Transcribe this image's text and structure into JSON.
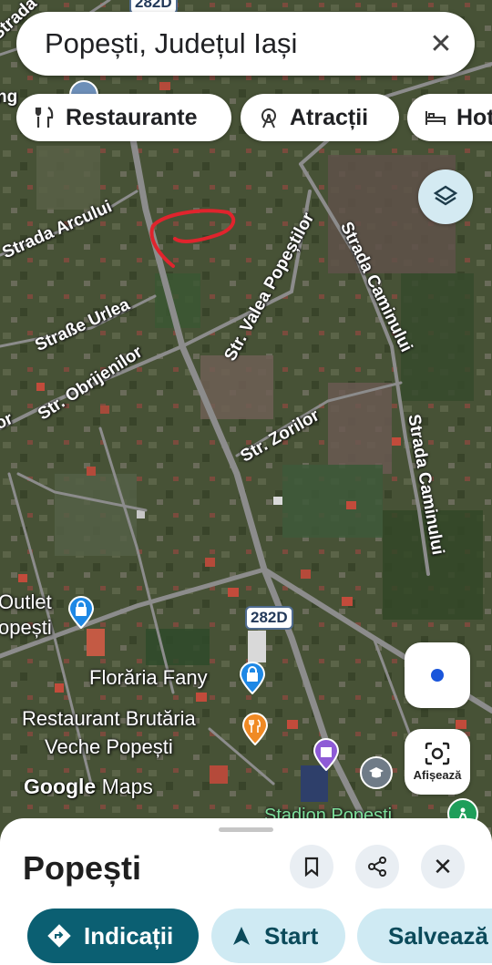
{
  "search": {
    "query": "Popești, Județul Iași"
  },
  "chips": [
    {
      "label": "Restaurante",
      "icon": "fork-knife-icon"
    },
    {
      "label": "Atracții",
      "icon": "attractions-icon"
    },
    {
      "label": "Hot",
      "icon": "bed-icon"
    }
  ],
  "streets": {
    "arcului": "Strada Arcului",
    "urlea": "Straße Urlea",
    "obrijenilor": "Str. Obrijenilor",
    "valea_popestilor": "Str. Valea Popeștilor",
    "zorilor": "Str. Zorilor",
    "caminului_1": "Strada Caminului",
    "caminului_2": "Strada Caminului",
    "top_partial": "Strada",
    "left_partial": "ng",
    "left_partial2": "or"
  },
  "route_shields": {
    "top": "282D",
    "mid": "282D"
  },
  "places": {
    "outlet_line1": "Outlet",
    "outlet_line2": "opești",
    "floraria": "Florăria Fany",
    "restaurant_line1": "Restaurant Brutăria",
    "restaurant_line2": "Veche Popești",
    "stadion": "Stadion Popești"
  },
  "branding": {
    "google": "Google",
    "maps": "Maps"
  },
  "controls": {
    "show_label": "Afișează"
  },
  "sheet": {
    "title": "Popești",
    "actions": [
      {
        "label": "Indicații",
        "icon": "directions-icon"
      },
      {
        "label": "Start",
        "icon": "navigation-arrow-icon"
      },
      {
        "label": "Salvează",
        "icon": "bookmark-icon"
      }
    ]
  },
  "colors": {
    "primary": "#0b5f72",
    "light_action": "#cfeaf3",
    "poi_blue": "#1e88e5",
    "poi_orange": "#f08a24",
    "poi_purple": "#8e5bd6",
    "poi_green": "#1e9e5a",
    "annotation": "#e0242d"
  }
}
